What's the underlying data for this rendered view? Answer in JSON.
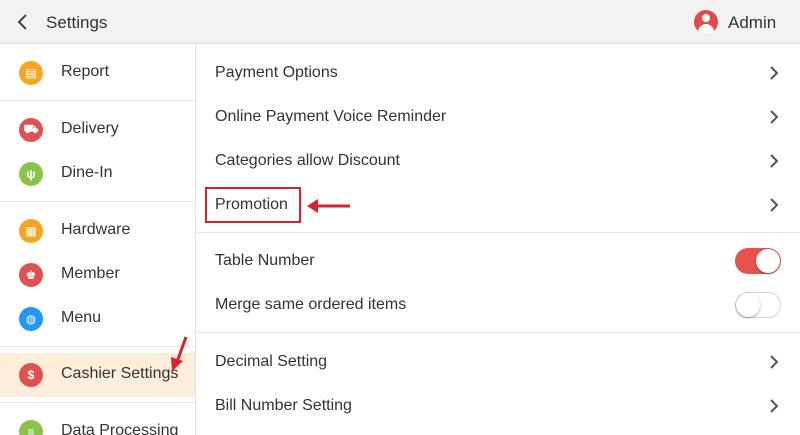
{
  "header": {
    "title": "Settings",
    "user": "Admin"
  },
  "sidebar": {
    "items": [
      {
        "label": "Report",
        "color": "#f5a623",
        "glyph": "▤"
      },
      {
        "label": "Delivery",
        "color": "#e05252",
        "glyph": "⛟"
      },
      {
        "label": "Dine-In",
        "color": "#8bc34a",
        "glyph": "ψ"
      },
      {
        "label": "Hardware",
        "color": "#f5a623",
        "glyph": "▦"
      },
      {
        "label": "Member",
        "color": "#e05252",
        "glyph": "♚"
      },
      {
        "label": "Menu",
        "color": "#2196f3",
        "glyph": "◍"
      },
      {
        "label": "Cashier Settings",
        "color": "#e05252",
        "glyph": "$"
      },
      {
        "label": "Data Processing",
        "color": "#8bc34a",
        "glyph": "≡"
      }
    ]
  },
  "content": {
    "rows": [
      {
        "label": "Payment Options"
      },
      {
        "label": "Online Payment Voice Reminder"
      },
      {
        "label": "Categories allow Discount"
      },
      {
        "label": "Promotion"
      },
      {
        "label": "Table Number",
        "toggle": true
      },
      {
        "label": "Merge same ordered items",
        "toggle": false
      },
      {
        "label": "Decimal Setting"
      },
      {
        "label": "Bill Number Setting"
      }
    ]
  },
  "colors": {
    "accent": "#e4524a",
    "active_bg": "#fdeedb",
    "annotation": "#d8232a"
  }
}
